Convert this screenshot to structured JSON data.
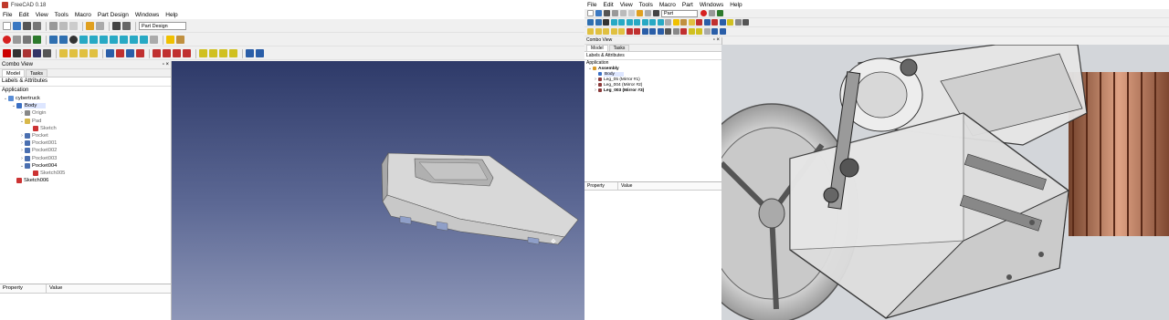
{
  "left_window": {
    "title": "FreeCAD 0.18",
    "menu": [
      "File",
      "Edit",
      "View",
      "Tools",
      "Macro",
      "Part Design",
      "Windows",
      "Help"
    ],
    "workbench": "Part Design",
    "combo_view": {
      "title": "Combo View",
      "tabs": [
        "Model",
        "Tasks"
      ],
      "section": "Labels & Attributes",
      "application": "Application",
      "tree": [
        {
          "label": "cybertruck",
          "level": 0,
          "expanded": true,
          "icon": "document-icon"
        },
        {
          "label": "Body",
          "level": 1,
          "expanded": true,
          "icon": "body-icon",
          "selected": true
        },
        {
          "label": "Origin",
          "level": 2,
          "expanded": false,
          "icon": "origin-icon",
          "dim": true
        },
        {
          "label": "Pad",
          "level": 2,
          "expanded": true,
          "icon": "pad-icon",
          "dim": true
        },
        {
          "label": "Sketch",
          "level": 3,
          "expanded": null,
          "icon": "sketch-icon",
          "dim": true
        },
        {
          "label": "Pocket",
          "level": 2,
          "expanded": false,
          "icon": "pocket-icon",
          "dim": true
        },
        {
          "label": "Pocket001",
          "level": 2,
          "expanded": false,
          "icon": "pocket-icon",
          "dim": true
        },
        {
          "label": "Pocket002",
          "level": 2,
          "expanded": false,
          "icon": "pocket-icon",
          "dim": true
        },
        {
          "label": "Pocket003",
          "level": 2,
          "expanded": false,
          "icon": "pocket-icon",
          "dim": true
        },
        {
          "label": "Pocket004",
          "level": 2,
          "expanded": true,
          "icon": "pocket-icon",
          "dim": false
        },
        {
          "label": "Sketch005",
          "level": 3,
          "expanded": null,
          "icon": "sketch-icon",
          "dim": true
        },
        {
          "label": "Sketch006",
          "level": 1,
          "expanded": null,
          "icon": "sketch-icon",
          "dim": false
        }
      ],
      "property_header": [
        "Property",
        "Value"
      ]
    }
  },
  "right_window": {
    "menu": [
      "File",
      "Edit",
      "View",
      "Tools",
      "Macro",
      "Part",
      "Windows",
      "Help"
    ],
    "workbench": "Part",
    "combo_view": {
      "title": "Combo View",
      "tabs": [
        "Model",
        "Tasks"
      ],
      "section": "Labels & Attributes",
      "application": "Application",
      "tree": [
        {
          "label": "Assembly",
          "level": 0,
          "expanded": true,
          "icon": "assembly-icon",
          "bold": true
        },
        {
          "label": "Body",
          "level": 1,
          "expanded": null,
          "icon": "body-icon",
          "selected": true
        },
        {
          "label": "Leg_05 (Mirror #1)",
          "level": 1,
          "expanded": false,
          "icon": "mirror-icon"
        },
        {
          "label": "Leg_004 (Mirror #2)",
          "level": 1,
          "expanded": false,
          "icon": "mirror-icon"
        },
        {
          "label": "Leg_003 (Mirror #3)",
          "level": 1,
          "expanded": false,
          "icon": "mirror-icon",
          "bold": true
        }
      ],
      "property_header": [
        "Property",
        "Value"
      ]
    }
  },
  "colors": {
    "viewport_top": "#2e3a69",
    "viewport_bottom": "#8e97b8",
    "selection": "#dde6ff",
    "model_gray": "#b9b9b9",
    "copper": "#c0704a"
  }
}
